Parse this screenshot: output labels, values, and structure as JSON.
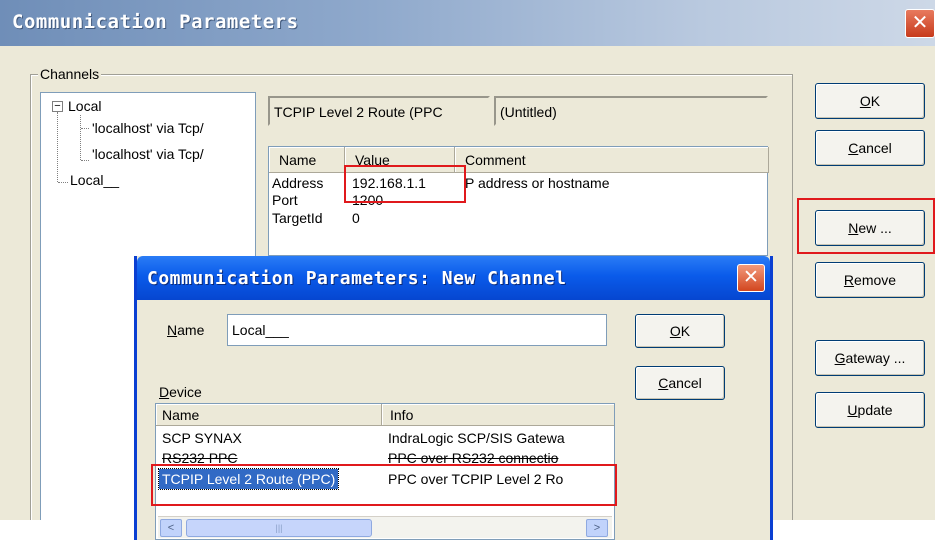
{
  "main": {
    "title": "Communication Parameters",
    "close_glyph": "✕",
    "channels_label": "Channels",
    "tree": {
      "root": "Local",
      "expander": "−",
      "children": [
        "'localhost' via Tcp/",
        "'localhost' via Tcp/"
      ],
      "leaf": "Local__"
    },
    "channel_type": "TCPIP  Level 2 Route (PPC",
    "channel_name": "(Untitled)",
    "table": {
      "headers": [
        "Name",
        "Value",
        "Comment"
      ],
      "rows": [
        {
          "name": "Address",
          "value": "192.168.1.1",
          "comment": "P address or hostname"
        },
        {
          "name": "Port",
          "value": "1200",
          "comment": ""
        },
        {
          "name": "TargetId",
          "value": "0",
          "comment": ""
        }
      ]
    },
    "buttons": {
      "ok": {
        "mnemonic": "O",
        "rest": "K"
      },
      "cancel": {
        "mnemonic": "C",
        "rest": "ancel"
      },
      "new": {
        "mnemonic": "N",
        "rest": "ew ..."
      },
      "remove": {
        "mnemonic": "R",
        "rest": "emove"
      },
      "gateway": {
        "mnemonic": "G",
        "rest": "ateway ..."
      },
      "update": {
        "mnemonic": "U",
        "rest": "pdate"
      }
    }
  },
  "sub": {
    "title": "Communication Parameters: New Channel",
    "close_glyph": "✕",
    "name_label": {
      "mnemonic": "N",
      "rest": "ame"
    },
    "name_value": "Local___",
    "device_label": {
      "mnemonic": "D",
      "rest": "evice"
    },
    "buttons": {
      "ok": {
        "mnemonic": "O",
        "rest": "K"
      },
      "cancel": {
        "mnemonic": "C",
        "rest": "ancel"
      }
    },
    "device_table": {
      "headers": [
        "Name",
        "Info"
      ],
      "rows": [
        {
          "name": "SCP SYNAX",
          "info": "IndraLogic SCP/SIS Gatewa",
          "selected": false
        },
        {
          "name": "RS232 PPC",
          "info": "PPC over RS232 connectio",
          "selected": false
        },
        {
          "name": "TCPIP  Level 2 Route (PPC)",
          "info": "PPC over TCPIP  Level 2 Ro",
          "selected": true
        }
      ]
    },
    "scroll": {
      "left": "<",
      "right": ">",
      "thumb_grip": "|||"
    }
  },
  "colors": {
    "highlight": "#e0191c",
    "selection": "#316ac5"
  }
}
